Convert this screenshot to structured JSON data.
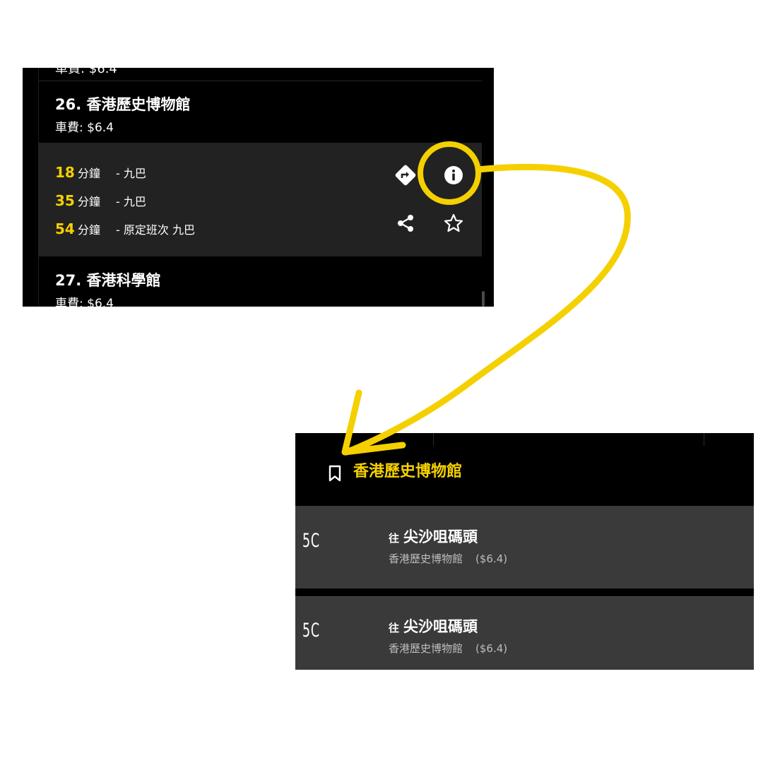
{
  "top_screen": {
    "cut_off_text": "車費: $6.4",
    "stops": [
      {
        "name": "26. 香港歷史博物館",
        "fare": "車費: $6.4",
        "etas": [
          {
            "minutes": "18",
            "unit": "分鐘",
            "desc": "- 九巴"
          },
          {
            "minutes": "35",
            "unit": "分鐘",
            "desc": "- 九巴"
          },
          {
            "minutes": "54",
            "unit": "分鐘",
            "desc": "- 原定班次 九巴"
          }
        ],
        "actions": [
          "directions-icon",
          "info-icon",
          "share-icon",
          "star-icon"
        ]
      },
      {
        "name": "27. 香港科學館",
        "fare": "車費: $6.4"
      }
    ]
  },
  "bottom_screen": {
    "header_title": "香港歷史博物館",
    "routes": [
      {
        "route": "5C",
        "prefix": "往",
        "destination": "尖沙咀碼頭",
        "stop": "香港歷史博物館",
        "fare": "($6.4)"
      },
      {
        "route": "5C",
        "prefix": "往",
        "destination": "尖沙咀碼頭",
        "stop": "香港歷史博物館",
        "fare": "($6.4)"
      }
    ]
  },
  "annotation": {
    "highlight_color": "#f5d000",
    "highlighted_target": "info-icon",
    "arrow_target": "bookmark-icon"
  }
}
